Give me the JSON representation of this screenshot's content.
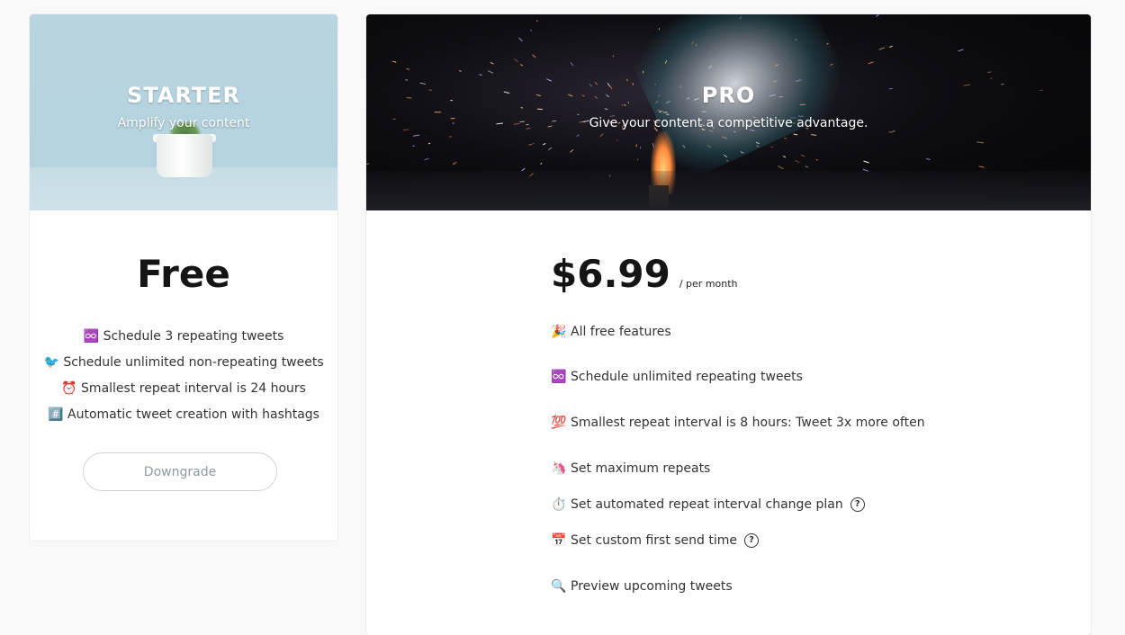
{
  "starter": {
    "title": "STARTER",
    "subtitle": "Amplify your content",
    "price": "Free",
    "features": [
      {
        "icon": "♾️",
        "icon_name": "infinity-icon",
        "text": "Schedule 3 repeating tweets"
      },
      {
        "icon": "🐦",
        "icon_name": "bird-icon",
        "text": "Schedule unlimited non-repeating tweets"
      },
      {
        "icon": "⏰",
        "icon_name": "alarm-clock-icon",
        "text": "Smallest repeat interval is 24 hours"
      },
      {
        "icon": "#️⃣",
        "icon_name": "hashtag-icon",
        "text": "Automatic tweet creation with hashtags"
      }
    ],
    "button_label": "Downgrade"
  },
  "pro": {
    "title": "PRO",
    "subtitle": "Give your content a competitive advantage.",
    "price": "$6.99",
    "period": "/ per month",
    "features": [
      {
        "icon": "🎉",
        "icon_name": "party-popper-icon",
        "text": "All free features",
        "help": false
      },
      {
        "icon": "♾️",
        "icon_name": "infinity-icon",
        "text": "Schedule unlimited repeating tweets",
        "help": false
      },
      {
        "icon": "💯",
        "icon_name": "hundred-points-icon",
        "text": "Smallest repeat interval is 8 hours: Tweet 3x more often",
        "help": false
      },
      {
        "icon": "🦄",
        "icon_name": "unicorn-icon",
        "text": "Set maximum repeats",
        "help": false
      },
      {
        "icon": "⏱️",
        "icon_name": "stopwatch-icon",
        "text": "Set automated repeat interval change plan",
        "help": true
      },
      {
        "icon": "📅",
        "icon_name": "calendar-icon",
        "text": "Set custom first send time",
        "help": true
      },
      {
        "icon": "🔍",
        "icon_name": "magnifier-icon",
        "text": "Preview upcoming tweets",
        "help": false
      }
    ],
    "help_glyph": "?"
  }
}
